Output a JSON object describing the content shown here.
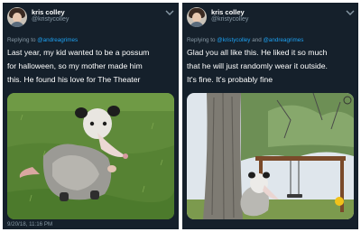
{
  "tweets": [
    {
      "author": {
        "name": "kris colley",
        "handle": "@kristycolley",
        "avatar_icon": "avatar-photo"
      },
      "menu_icon": "chevron-down-icon",
      "reply_to": {
        "prefix": "Replying to ",
        "mentions": [
          "@andreagrimes"
        ]
      },
      "body_lines": [
        "Last year, my kid wanted to be a possum",
        "for halloween, so my mother made him",
        "this. He found his love for The Theater"
      ],
      "media": {
        "description_icon": "possum-costume-kid-photo"
      },
      "timestamp": "9/20/18, 11:16 PM"
    },
    {
      "author": {
        "name": "kris colley",
        "handle": "@kristycolley",
        "avatar_icon": "avatar-photo"
      },
      "menu_icon": "chevron-down-icon",
      "reply_to": {
        "prefix": "Replying to ",
        "mentions": [
          "@kristycolley",
          "@andreagrimes"
        ],
        "joiner": " and "
      },
      "body_lines": [
        "Glad you all like this. He liked it so much",
        "that he will just randomly wear it outside.",
        "It's fine. It's probably fine"
      ],
      "media": {
        "description_icon": "possum-costume-tree-photo"
      }
    }
  ],
  "colors": {
    "background": "#15202b",
    "text": "#ffffff",
    "muted": "#8899a6",
    "link": "#1da1f2"
  }
}
